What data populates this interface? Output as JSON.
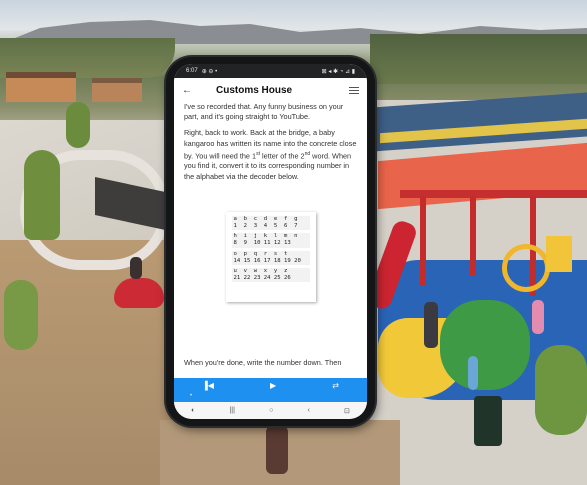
{
  "status_bar": {
    "time": "6:07",
    "left_icons": "⊕ ⊖ •",
    "right_icons": "⊠ ◂ ✱ ◔ ⊿ ▮"
  },
  "app_bar": {
    "title": "Customs House"
  },
  "content": {
    "para1": "I've so recorded that. Any funny business on your part, and it's going straight to YouTube.",
    "para2_a": "Right, back to work. Back at the bridge, a baby kangaroo has written its name into the concrete close by. You will need the 1",
    "para2_sup1": "st",
    "para2_b": " letter of the 2",
    "para2_sup2": "nd",
    "para2_c": " word. When you find it, convert it to its corresponding number in the alphabet via the decoder below.",
    "bottom": "When you're done, write the number down. Then"
  },
  "decoder": {
    "rows": [
      {
        "letters": "a  b  c  d  e  f  g",
        "numbers": "1  2  3  4  5  6  7"
      },
      {
        "letters": "h  i  j  k  l  m  n",
        "numbers": "8  9  10 11 12 13"
      },
      {
        "letters": "o  p  q  r  s  t",
        "numbers": "14 15 16 17 18 19 20"
      },
      {
        "letters": "u  v  w  x  y  z",
        "numbers": "21 22 23 24 25 26"
      }
    ]
  },
  "player": {
    "prev_icon": "▐◀",
    "play_icon": "▶",
    "repeat_icon": "⇄",
    "dot": "•"
  },
  "nav_bar": {
    "assistant_icon": "◐",
    "recents_icon": "|||",
    "home_icon": "○",
    "back_icon": "‹",
    "accessibility_icon": "⊡"
  }
}
